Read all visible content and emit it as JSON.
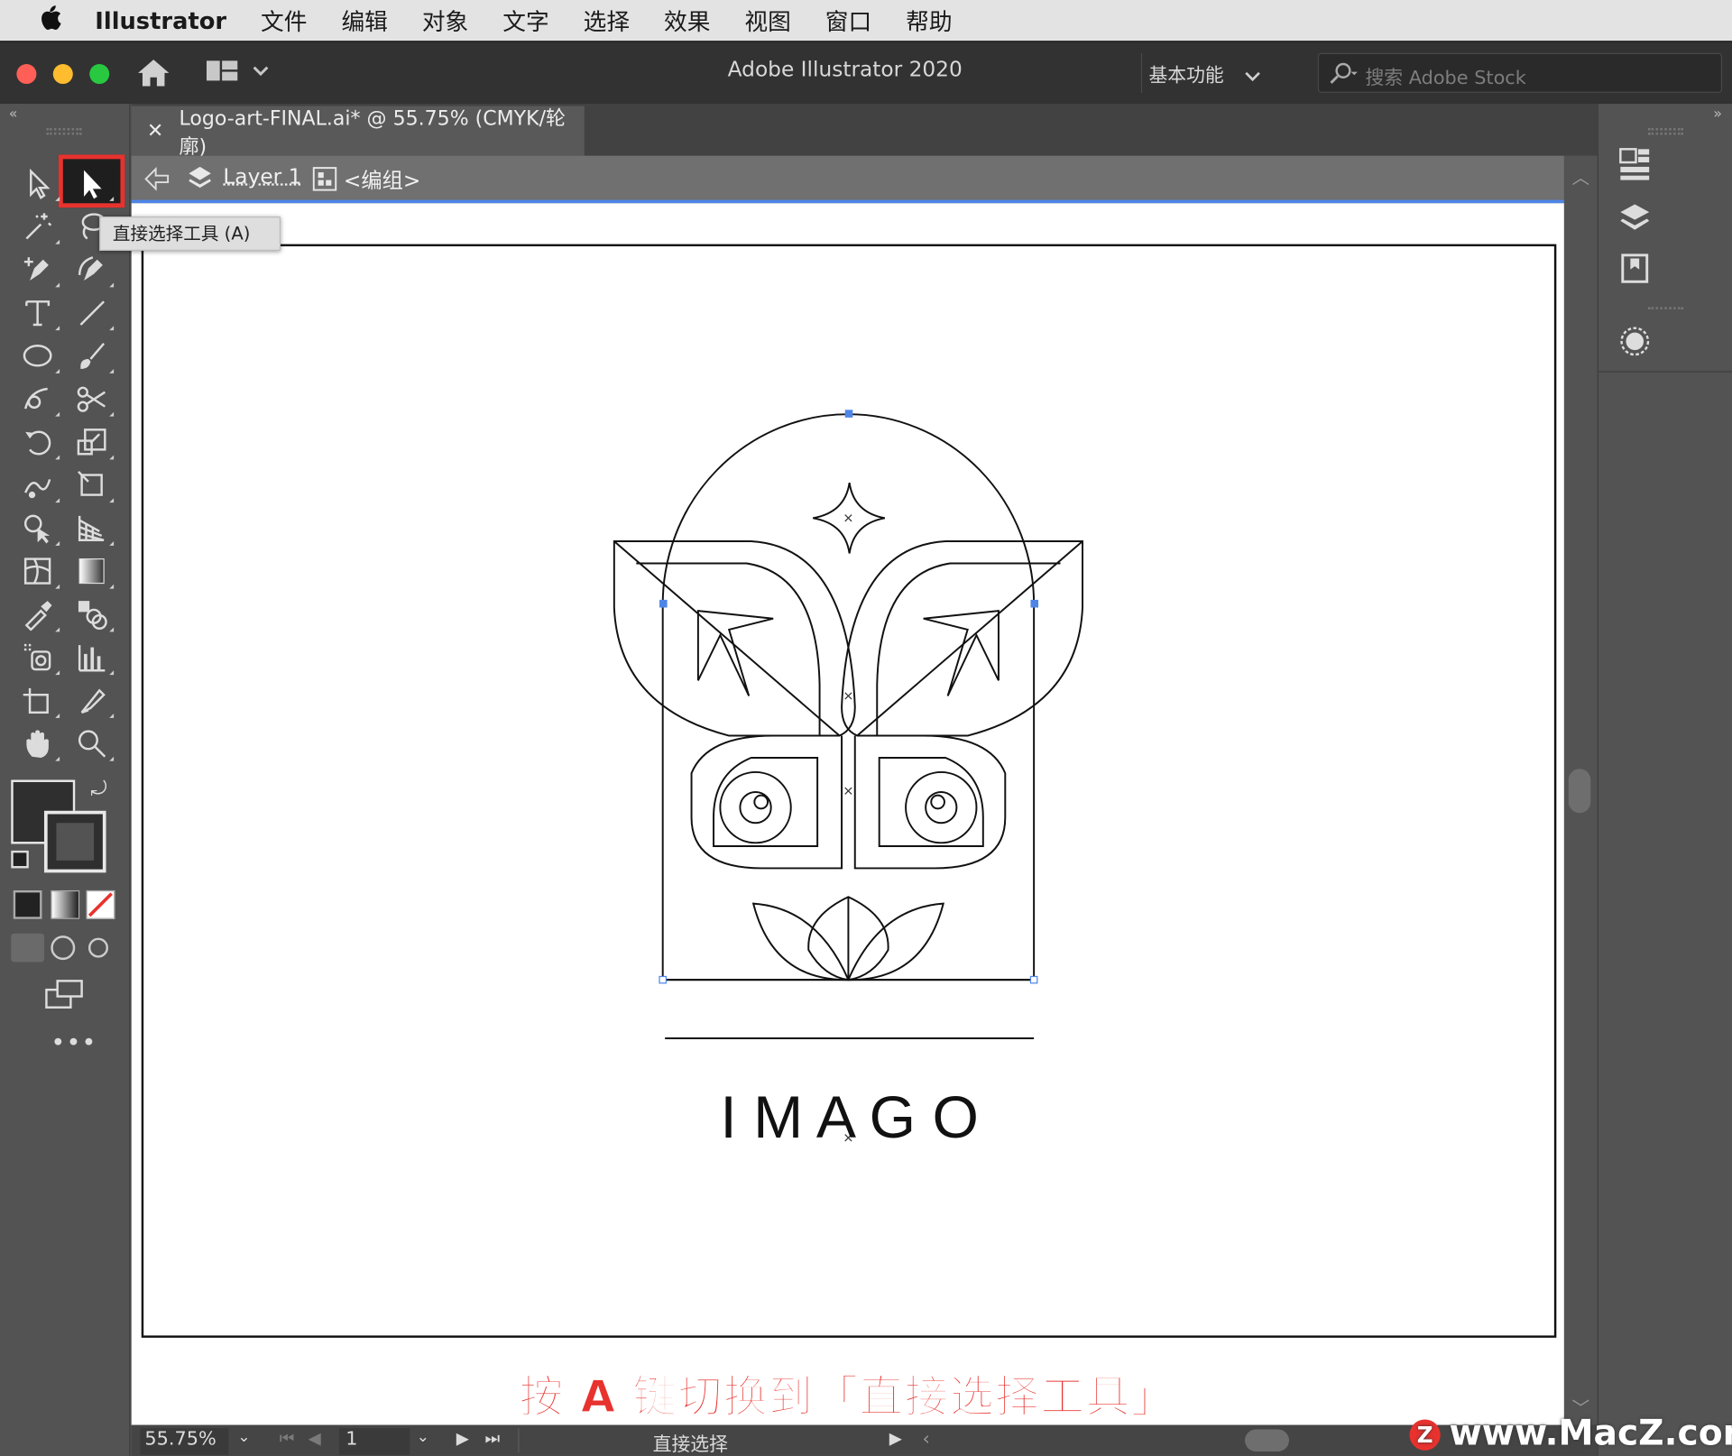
{
  "menubar": {
    "app": "Illustrator",
    "items": [
      "文件",
      "编辑",
      "对象",
      "文字",
      "选择",
      "效果",
      "视图",
      "窗口",
      "帮助"
    ]
  },
  "appbar": {
    "title": "Adobe Illustrator 2020",
    "workspace": "基本功能",
    "search_placeholder": "搜索 Adobe Stock"
  },
  "document": {
    "tab_title": "Logo-art-FINAL.ai* @ 55.75% (CMYK/轮廓)",
    "breadcrumb_layer": "Layer 1",
    "breadcrumb_group": "<编组>"
  },
  "tooltip": "直接选择工具 (A)",
  "artwork": {
    "wordmark": "I M A G O"
  },
  "status": {
    "zoom": "55.75%",
    "artboard": "1",
    "tool_name": "直接选择"
  },
  "caption": "按 A 键切换到「直接选择工具」",
  "watermark": "www.MacZ.com",
  "colors": {
    "close": "#ff5f57",
    "minimize": "#febc2e",
    "zoom": "#28c840",
    "selection": "#4e86e8",
    "highlight": "#e8322e"
  },
  "tools": [
    "selection-tool",
    "direct-selection-tool",
    "magic-wand-tool",
    "lasso-tool",
    "pen-tool",
    "curvature-tool",
    "type-tool",
    "line-tool",
    "ellipse-tool",
    "paintbrush-tool",
    "shaper-tool",
    "scissors-tool",
    "rotate-tool",
    "scale-tool",
    "warp-tool",
    "free-transform-tool",
    "shape-builder-tool",
    "perspective-grid-tool",
    "mesh-tool",
    "gradient-tool",
    "eyedropper-tool",
    "blend-tool",
    "symbol-sprayer-tool",
    "column-graph-tool",
    "artboard-tool",
    "slice-tool",
    "hand-tool",
    "zoom-tool"
  ]
}
